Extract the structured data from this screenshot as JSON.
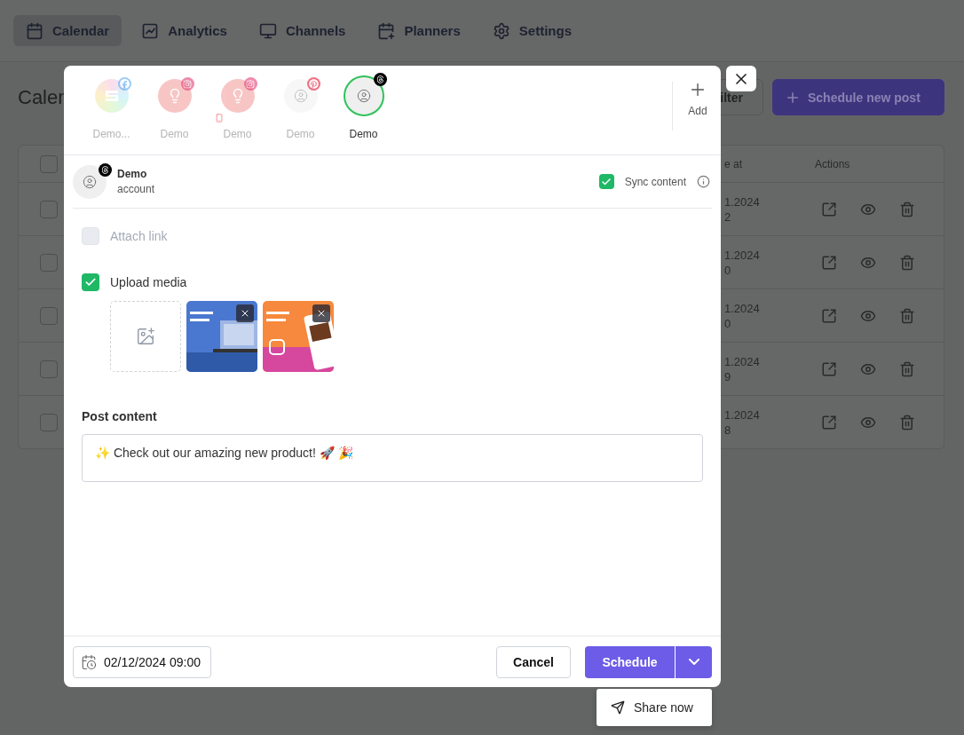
{
  "nav": {
    "tabs": [
      {
        "label": "Calendar",
        "selected": true
      },
      {
        "label": "Analytics",
        "selected": false
      },
      {
        "label": "Channels",
        "selected": false
      },
      {
        "label": "Planners",
        "selected": false
      },
      {
        "label": "Settings",
        "selected": false
      }
    ]
  },
  "page": {
    "title": "Calen",
    "filter_button": "ilter",
    "new_post_button": "Schedule new post"
  },
  "table": {
    "select_all": {
      "checked": false
    },
    "columns": [
      "e at",
      "Actions"
    ],
    "rows": [
      {
        "checked": false,
        "date": "1.2024",
        "time": "2"
      },
      {
        "checked": false,
        "date": "1.2024",
        "time": "0"
      },
      {
        "checked": false,
        "date": "1.2024",
        "time": "0"
      },
      {
        "checked": false,
        "date": "1.2024",
        "time": "9"
      },
      {
        "checked": false,
        "date": "1.2024",
        "time": "8"
      }
    ]
  },
  "composer": {
    "accounts": [
      {
        "name": "Demo...",
        "selected": false
      },
      {
        "name": "Demo",
        "selected": false
      },
      {
        "name": "Demo",
        "selected": false
      },
      {
        "name": "Demo",
        "selected": false
      },
      {
        "name": "Demo",
        "selected": true
      }
    ],
    "add_label": "Add",
    "current_account": {
      "name": "Demo",
      "subtitle": "account"
    },
    "sync_content": {
      "label": "Sync content",
      "checked": true
    },
    "options": [
      {
        "label": "Attach link",
        "checked": false,
        "disabled": true
      },
      {
        "label": "Upload media",
        "checked": true,
        "disabled": false
      }
    ],
    "post_content": {
      "label": "Post content",
      "value": "✨ Check out our amazing new product! 🚀 🎉"
    },
    "date": "02/12/2024 09:00",
    "cancel_button": "Cancel",
    "schedule_button": "Schedule",
    "schedule_menu": [
      {
        "label": "Share now"
      }
    ]
  }
}
